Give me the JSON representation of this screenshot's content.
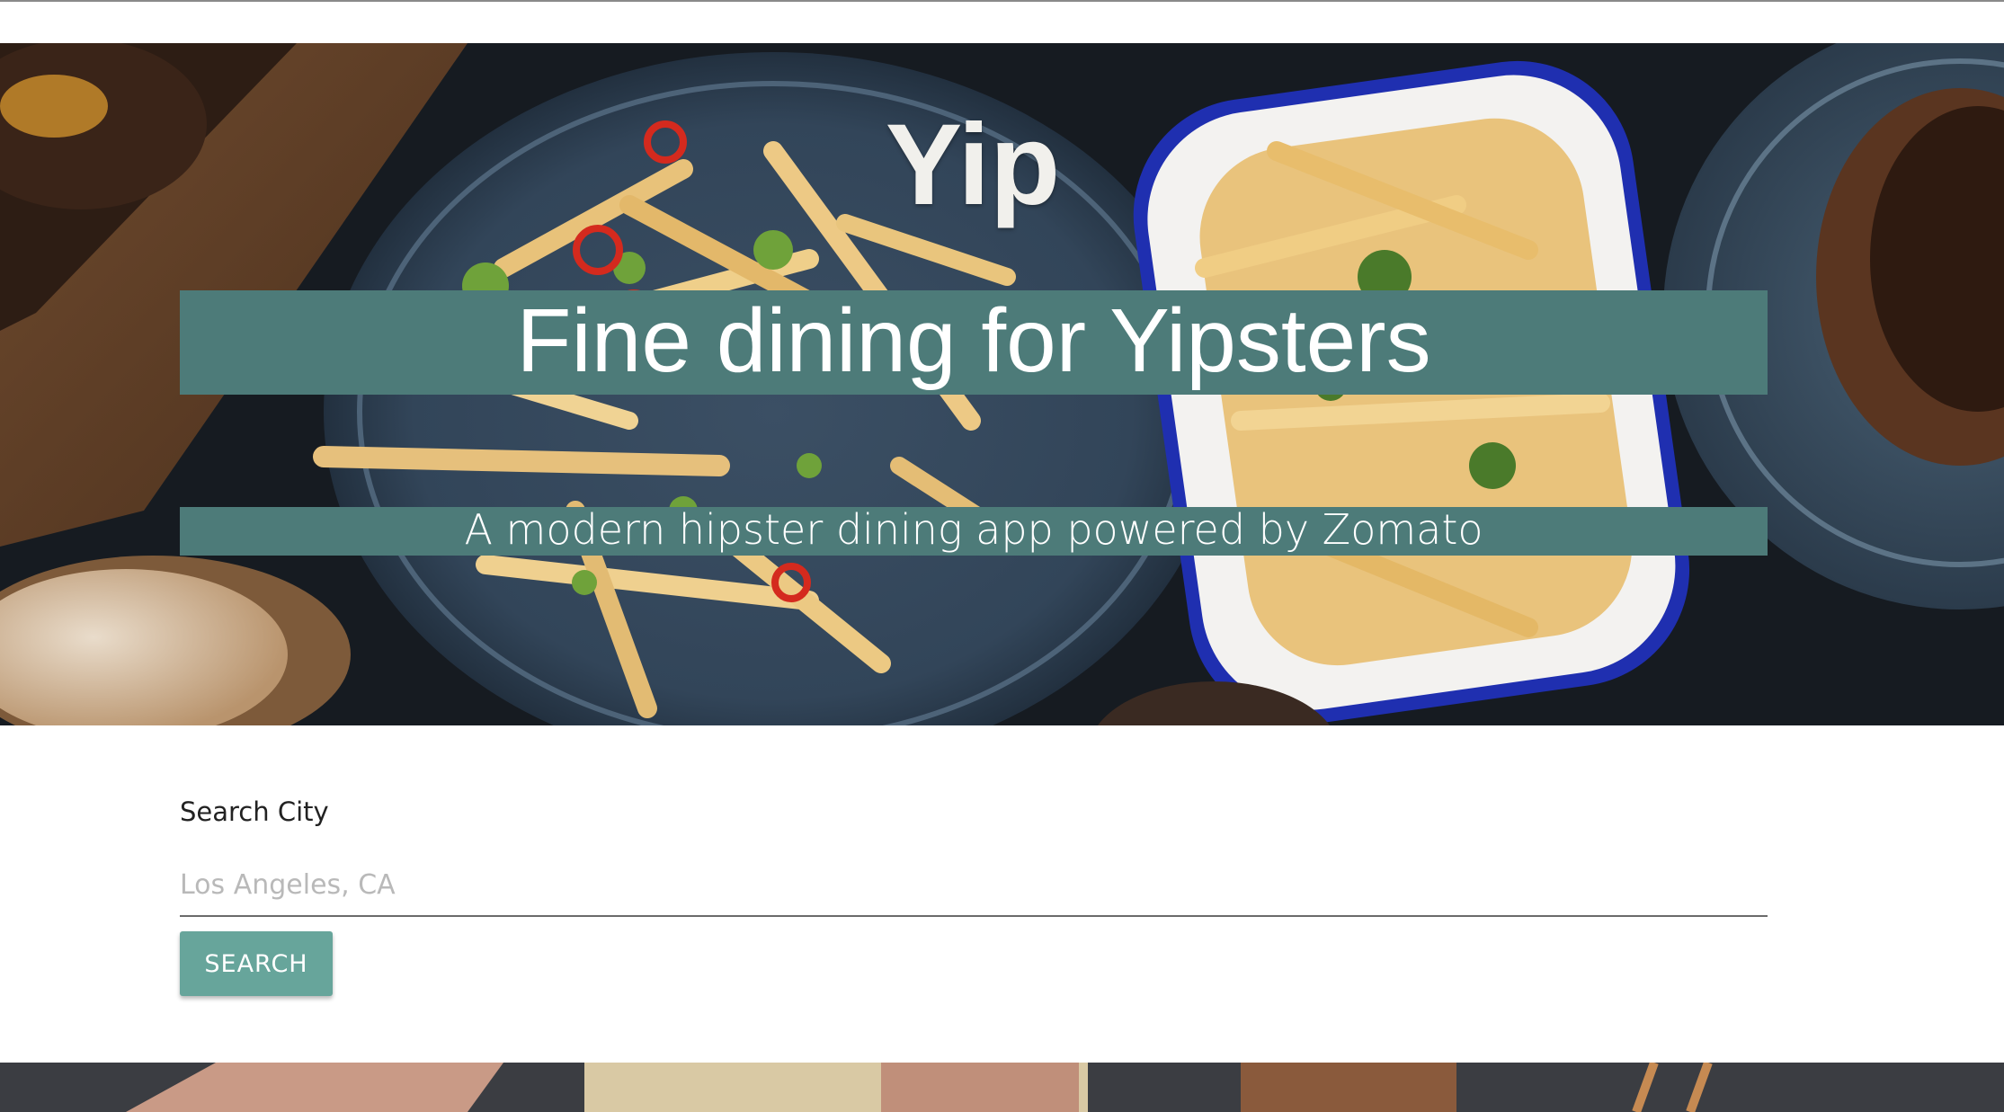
{
  "hero": {
    "title": "Yip",
    "tagline": "Fine dining for Yipsters",
    "subtitle": "A modern hipster dining app powered by Zomato",
    "band_color": "#4d7b79",
    "image_alt": "food-photo-background"
  },
  "search": {
    "label": "Search City",
    "placeholder": "Los Angeles, CA",
    "value": "",
    "button_label": "SEARCH",
    "button_color": "#67a59b"
  }
}
